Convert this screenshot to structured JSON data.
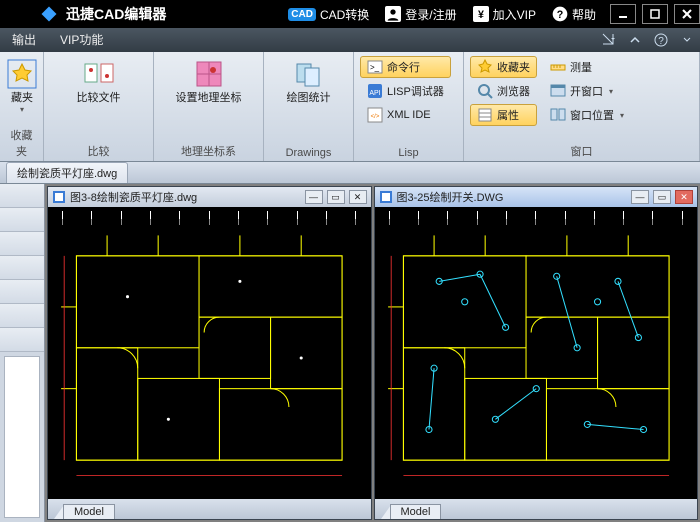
{
  "titlebar": {
    "app_title": "迅捷CAD编辑器",
    "cad_badge": "CAD",
    "cad_convert": "CAD转换",
    "login": "登录/注册",
    "vip": "加入VIP",
    "help": "帮助"
  },
  "menubar": {
    "output": "输出",
    "vip_func": "VIP功能"
  },
  "ribbon": {
    "group0": {
      "btn": "藏夹",
      "sub": "收藏夹"
    },
    "group1": {
      "btn": "比较文件",
      "label": "比较"
    },
    "group2": {
      "btn": "设置地理坐标",
      "label": "地理坐标系"
    },
    "group3": {
      "btn": "绘图统计",
      "label": "Drawings"
    },
    "group4": {
      "cmd": "命令行",
      "lisp": "LISP调试器",
      "xml": "XML IDE",
      "label": "Lisp"
    },
    "group5": {
      "fav": "收藏夹",
      "browser": "浏览器",
      "prop": "属性",
      "measure": "测量",
      "openwin": "开窗口",
      "winpos": "窗口位置",
      "label": "窗口"
    }
  },
  "tabstrip": {
    "tab0": "绘制瓷质平灯座.dwg"
  },
  "docs": {
    "left": {
      "title": "图3-8绘制瓷质平灯座.dwg",
      "model": "Model"
    },
    "right": {
      "title": "图3-25绘制开关.DWG",
      "model": "Model"
    }
  }
}
